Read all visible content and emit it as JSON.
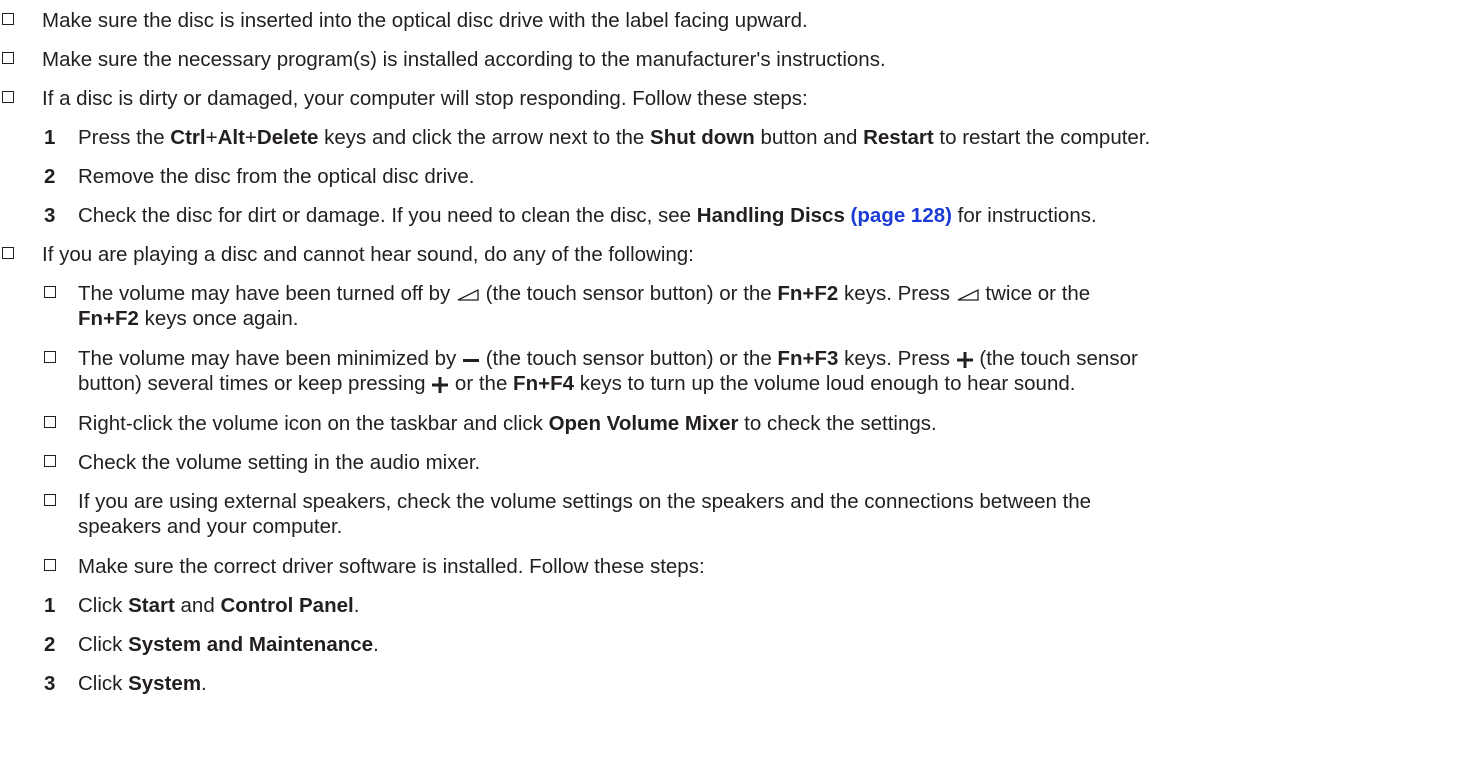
{
  "item1": "Make sure the disc is inserted into the optical disc drive with the label facing upward.",
  "item2": "Make sure the necessary program(s) is installed according to the manufacturer's instructions.",
  "item3": "If a disc is dirty or damaged, your computer will stop responding. Follow these steps:",
  "steps1": {
    "s1": {
      "num": "1",
      "pre": "Press the ",
      "k1": "Ctrl",
      "plus1": "+",
      "k2": "Alt",
      "plus2": "+",
      "k3": "Delete",
      "mid": " keys and click the arrow next to the ",
      "b1": "Shut down",
      "mid2": " button and ",
      "b2": "Restart",
      "post": " to restart the computer."
    },
    "s2": {
      "num": "2",
      "text": "Remove the disc from the optical disc drive."
    },
    "s3": {
      "num": "3",
      "pre": "Check the disc for dirt or damage. If you need to clean the disc, see ",
      "bold": "Handling Discs",
      "link": " (page 128)",
      "post": " for instructions."
    }
  },
  "item4": "If you are playing a disc and cannot hear sound, do any of the following:",
  "sub1": {
    "pre": "The volume may have been turned off by ",
    "mid": " (the touch sensor button) or the ",
    "keys": "Fn+F2",
    "mid2": " keys. Press ",
    "mid3": " twice or the",
    "keys2": "Fn+F2",
    "post": " keys once again."
  },
  "sub2": {
    "pre": "The volume may have been minimized by ",
    "mid": " (the touch sensor button) or the ",
    "keys": "Fn+F3",
    "mid2": " keys. Press ",
    "mid3": " (the touch sensor",
    "line2a": "button) several times or keep pressing ",
    "line2b": " or the ",
    "keys2": "Fn+F4",
    "post": " keys to turn up the volume loud enough to hear sound."
  },
  "sub3": {
    "pre": "Right-click the volume icon on the taskbar and click ",
    "bold": "Open Volume Mixer",
    "post": " to check the settings."
  },
  "sub4": "Check the volume setting in the audio mixer.",
  "sub5": {
    "line1": "If you are using external speakers, check the volume settings on the speakers and the connections between the",
    "line2": "speakers and your computer."
  },
  "sub6": "Make sure the correct driver software is installed. Follow these steps:",
  "steps2": {
    "s1": {
      "num": "1",
      "pre": "Click ",
      "b1": "Start",
      "mid": " and ",
      "b2": "Control Panel",
      "post": "."
    },
    "s2": {
      "num": "2",
      "pre": "Click ",
      "b1": "System and Maintenance",
      "post": "."
    },
    "s3": {
      "num": "3",
      "pre": "Click ",
      "b1": "System",
      "post": "."
    }
  }
}
